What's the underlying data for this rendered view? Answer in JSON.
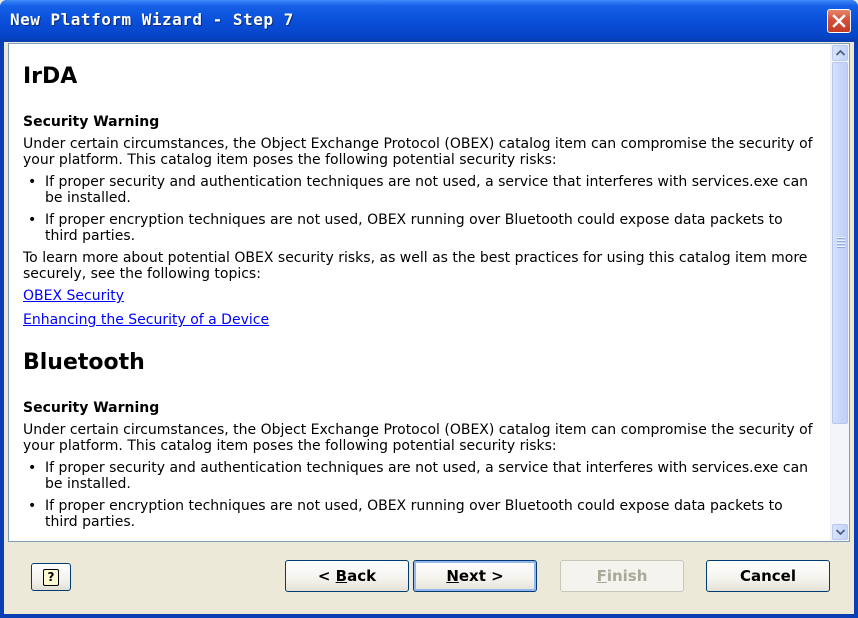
{
  "window": {
    "title": "New Platform Wizard - Step 7"
  },
  "sections": [
    {
      "heading": "IrDA",
      "subheading": "Security Warning",
      "intro": "Under certain circumstances, the Object Exchange Protocol (OBEX) catalog item can compromise the security of your platform. This catalog item poses the following potential security risks:",
      "bullets": [
        "If proper security and authentication techniques are not used, a service that interferes with services.exe can be installed.",
        "If proper encryption techniques are not used, OBEX running over Bluetooth could expose data packets to third parties."
      ],
      "learn_more": "To learn more about potential OBEX security risks, as well as the best practices for using this catalog item more securely, see the following topics:",
      "links": [
        "OBEX Security",
        "Enhancing the Security of a Device"
      ]
    },
    {
      "heading": "Bluetooth",
      "subheading": "Security Warning",
      "intro": "Under certain circumstances, the Object Exchange Protocol (OBEX) catalog item can compromise the security of your platform. This catalog item poses the following potential security risks:",
      "bullets": [
        "If proper security and authentication techniques are not used, a service that interferes with services.exe can be installed.",
        "If proper encryption techniques are not used, OBEX running over Bluetooth could expose data packets to third parties."
      ]
    }
  ],
  "bullet_glyph": "•",
  "buttons": {
    "back": {
      "prefix": "< ",
      "accel": "B",
      "rest": "ack"
    },
    "next": {
      "accel": "N",
      "rest": "ext >"
    },
    "finish": {
      "accel": "F",
      "rest": "inish"
    },
    "cancel": "Cancel",
    "help_glyph": "?"
  },
  "scrollbar": {
    "position_fraction": 0.0
  }
}
